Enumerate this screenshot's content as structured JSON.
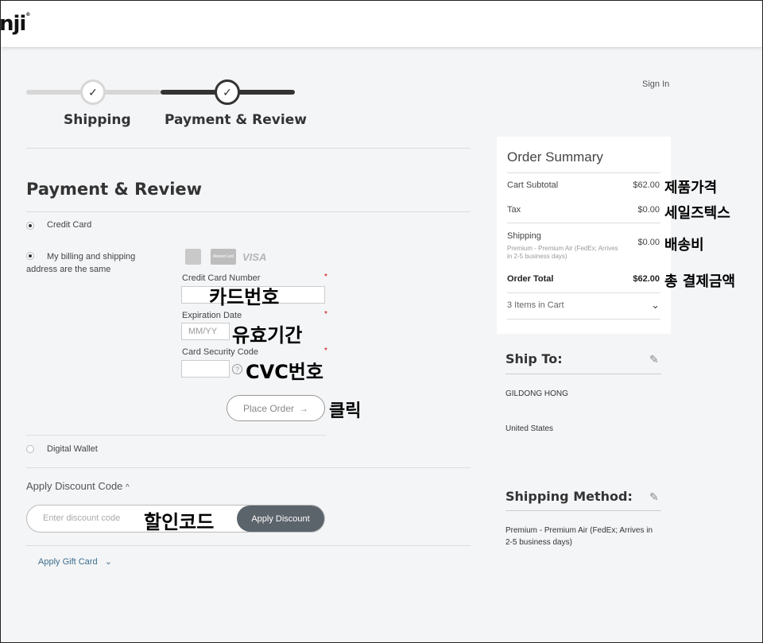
{
  "header": {
    "logo_text": "nji",
    "logo_mark": "®"
  },
  "account": {
    "sign_in": "Sign In"
  },
  "steps": [
    {
      "label": "Shipping",
      "icon": "check-icon",
      "glyph": "✓"
    },
    {
      "label": "Payment & Review",
      "icon": "check-icon",
      "glyph": "✓"
    }
  ],
  "payment": {
    "title": "Payment & Review",
    "credit_card_label": "Credit Card",
    "billing_same_label": "My billing and shipping address are the same",
    "card_brands": [
      "American Express",
      "MasterCard",
      "VISA"
    ],
    "visa_text": "VISA",
    "mc_text": "MasterCard",
    "amex_text": "AMEX",
    "card_number_label": "Credit Card Number",
    "card_number_value": "",
    "expiration_label": "Expiration Date",
    "expiration_placeholder": "MM/YY",
    "cvc_label": "Card Security Code",
    "cvc_help": "?",
    "required_mark": "*",
    "place_order_label": "Place Order",
    "place_order_arrow": "→",
    "digital_wallet_label": "Digital Wallet"
  },
  "discount": {
    "toggle_label": "Apply Discount Code",
    "toggle_chevron": "^",
    "placeholder": "Enter discount code",
    "apply_label": "Apply Discount",
    "gift_card_label": "Apply Gift Card",
    "gift_chevron": "⌄"
  },
  "summary": {
    "title": "Order Summary",
    "rows": [
      {
        "label": "Cart Subtotal",
        "value": "$62.00"
      },
      {
        "label": "Tax",
        "value": "$0.00"
      },
      {
        "label": "Shipping",
        "value": "$0.00",
        "detail": "Premium - Premium Air (FedEx; Arrives in 2-5 business days)"
      },
      {
        "label": "Order Total",
        "value": "$62.00"
      }
    ],
    "items_in_cart": "3 Items in Cart",
    "items_chevron": "⌄"
  },
  "ship_to": {
    "title": "Ship To:",
    "name": "GILDONG HONG",
    "country": "United States"
  },
  "shipping_method": {
    "title": "Shipping Method:",
    "value": "Premium - Premium Air (FedEx; Arrives in 2-5 business days)"
  },
  "annotations": {
    "card_number": "카드번호",
    "expiration": "유효기간",
    "cvc": "CVC번호",
    "click": "클릭",
    "discount_code": "할인코드",
    "subtotal": "제품가격",
    "tax": "세일즈텍스",
    "shipping": "배송비",
    "total": "총 결제금액"
  },
  "colors": {
    "accent_dark": "#333333",
    "button_gray": "#5b636b",
    "required_red": "#cc0000"
  }
}
